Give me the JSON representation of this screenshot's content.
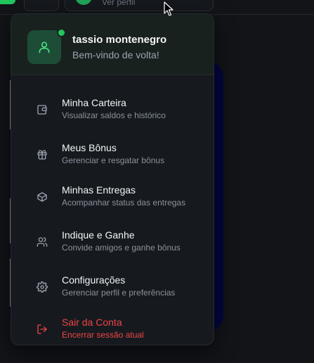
{
  "header": {
    "profile_subtitle": "Ver perfil"
  },
  "user": {
    "name": "tassio montenegro",
    "greeting": "Bem-vindo de volta!",
    "status": "online"
  },
  "menu": [
    {
      "icon": "wallet-icon",
      "title": "Minha Carteira",
      "description": "Visualizar saldos e histórico"
    },
    {
      "icon": "gift-icon",
      "title": "Meus Bônus",
      "description": "Gerenciar e resgatar bônus"
    },
    {
      "icon": "package-icon",
      "title": "Minhas Entregas",
      "description": "Acompanhar status das entregas"
    },
    {
      "icon": "users-icon",
      "title": "Indique e Ganhe",
      "description": "Convide amigos e ganhe bônus"
    },
    {
      "icon": "settings-icon",
      "title": "Configurações",
      "description": "Gerenciar perfil e preferências"
    }
  ],
  "logout": {
    "icon": "logout-icon",
    "title": "Sair da Conta",
    "description": "Encerrar sessão atual"
  },
  "colors": {
    "accent": "#22c55e",
    "danger": "#ef4444",
    "background": "#121418",
    "dropdown": "#161a1f"
  }
}
